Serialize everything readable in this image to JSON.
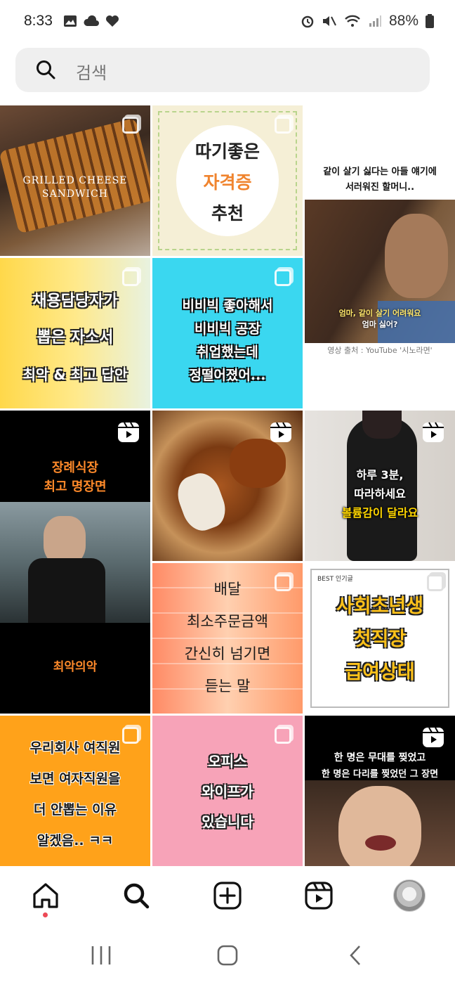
{
  "status": {
    "time": "8:33",
    "battery": "88%"
  },
  "search": {
    "placeholder": "검색"
  },
  "tiles": {
    "t1": {
      "caption_line1": "Grilled cheese",
      "caption_line2": "Sandwich"
    },
    "t2": {
      "line1": "따기좋은",
      "line2": "자격증",
      "line3": "추천"
    },
    "t3": {
      "caption_line1": "같이 살기 싫다는 아들 얘기에",
      "caption_line2": "서러워진 할머니..",
      "sub_line1": "엄마, 같이 살기 어려워요",
      "sub_line2": "엄마 싫어?",
      "source": "영상 출처 : YouTube '시노라면'"
    },
    "t4": {
      "line1": "채용담당자가",
      "line2": "뽑은 자소서",
      "line3": "최악 & 최고 답안"
    },
    "t5": {
      "line1": "비비빅 좋아해서",
      "line2": "비비빅 공장",
      "line3": "취업했는데",
      "line4": "정떨어졌어..."
    },
    "t6": {
      "line1": "장례식장",
      "line2": "최고 명장면",
      "bottom": "최악의악"
    },
    "t8": {
      "line1": "하루 3분,",
      "line2": "따라하세요",
      "line3": "볼륨감이 달라요"
    },
    "t9": {
      "line1": "배달",
      "line2": "최소주문금액",
      "line3": "간신히 넘기면",
      "line4": "듣는 말"
    },
    "t10": {
      "badge": "BEST 인기글",
      "line1": "사회초년생",
      "line2": "첫직장",
      "line3": "급여상태"
    },
    "t11": {
      "line1": "우리회사 여직원",
      "line2": "보면 여자직원을",
      "line3": "더 안뽑는 이유",
      "line4": "알겠음.. ㅋㅋ"
    },
    "t12": {
      "line1": "오피스",
      "line2": "와이프가",
      "line3": "있습니다"
    },
    "t13": {
      "line1": "한 명은 무대를 찢었고",
      "line2": "한 명은 다리를 찢었던 그 장면"
    }
  },
  "nav": {
    "items": [
      "home",
      "search",
      "create",
      "reels",
      "profile"
    ]
  },
  "colors": {
    "accent_red": "#ed4956",
    "search_bg": "#efefef"
  }
}
